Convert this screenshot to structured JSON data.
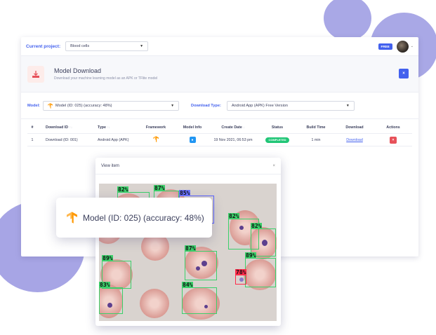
{
  "topbar": {
    "current_project_label": "Current project:",
    "project_value": "Blood cells",
    "plan_badge": "FREE"
  },
  "header": {
    "title": "Model Download",
    "subtitle": "Download your machine learning model as an APK or TFlite model",
    "icon": "download-icon",
    "close_label": "×"
  },
  "filters": {
    "model_label": "Model:",
    "model_value": "Model (ID: 025) (accuracy: 48%)",
    "download_type_label": "Download Type:",
    "download_type_value": "Android App (APK) Free Version"
  },
  "table": {
    "headers": {
      "num": "#",
      "id": "Download ID",
      "type": "Type",
      "framework": "Framework",
      "info": "Model Info",
      "date": "Create Date",
      "status": "Status",
      "build": "Build Time",
      "download": "Download",
      "actions": "Actions"
    },
    "rows": [
      {
        "num": "1",
        "id": "Download (ID: 001)",
        "type": "Android App (APK)",
        "framework_icon": "tensorflow-icon",
        "date": "19 Nov 2021, 06:53 pm",
        "status": "COMPLETED",
        "build": "1 min",
        "download": "Download",
        "action": "×"
      }
    ]
  },
  "modal": {
    "title": "View item",
    "close": "×",
    "detections": [
      {
        "label": "82%",
        "color": "green"
      },
      {
        "label": "87%",
        "color": "green"
      },
      {
        "label": "85%",
        "color": "blue"
      },
      {
        "label": "82%",
        "color": "green"
      },
      {
        "label": "82%",
        "color": "green"
      },
      {
        "label": "87%",
        "color": "green"
      },
      {
        "label": "89%",
        "color": "green"
      },
      {
        "label": "89%",
        "color": "green"
      },
      {
        "label": "78%",
        "color": "red"
      },
      {
        "label": "83%",
        "color": "green"
      },
      {
        "label": "84%",
        "color": "green"
      }
    ]
  },
  "callout": {
    "text": "Model (ID: 025) (accuracy: 48%)",
    "icon": "tensorflow-icon"
  },
  "colors": {
    "accent": "#4361ee",
    "success": "#21c677",
    "danger": "#e7515a",
    "blob": "#a9a8e6",
    "tensorflow": "#ff9800"
  }
}
